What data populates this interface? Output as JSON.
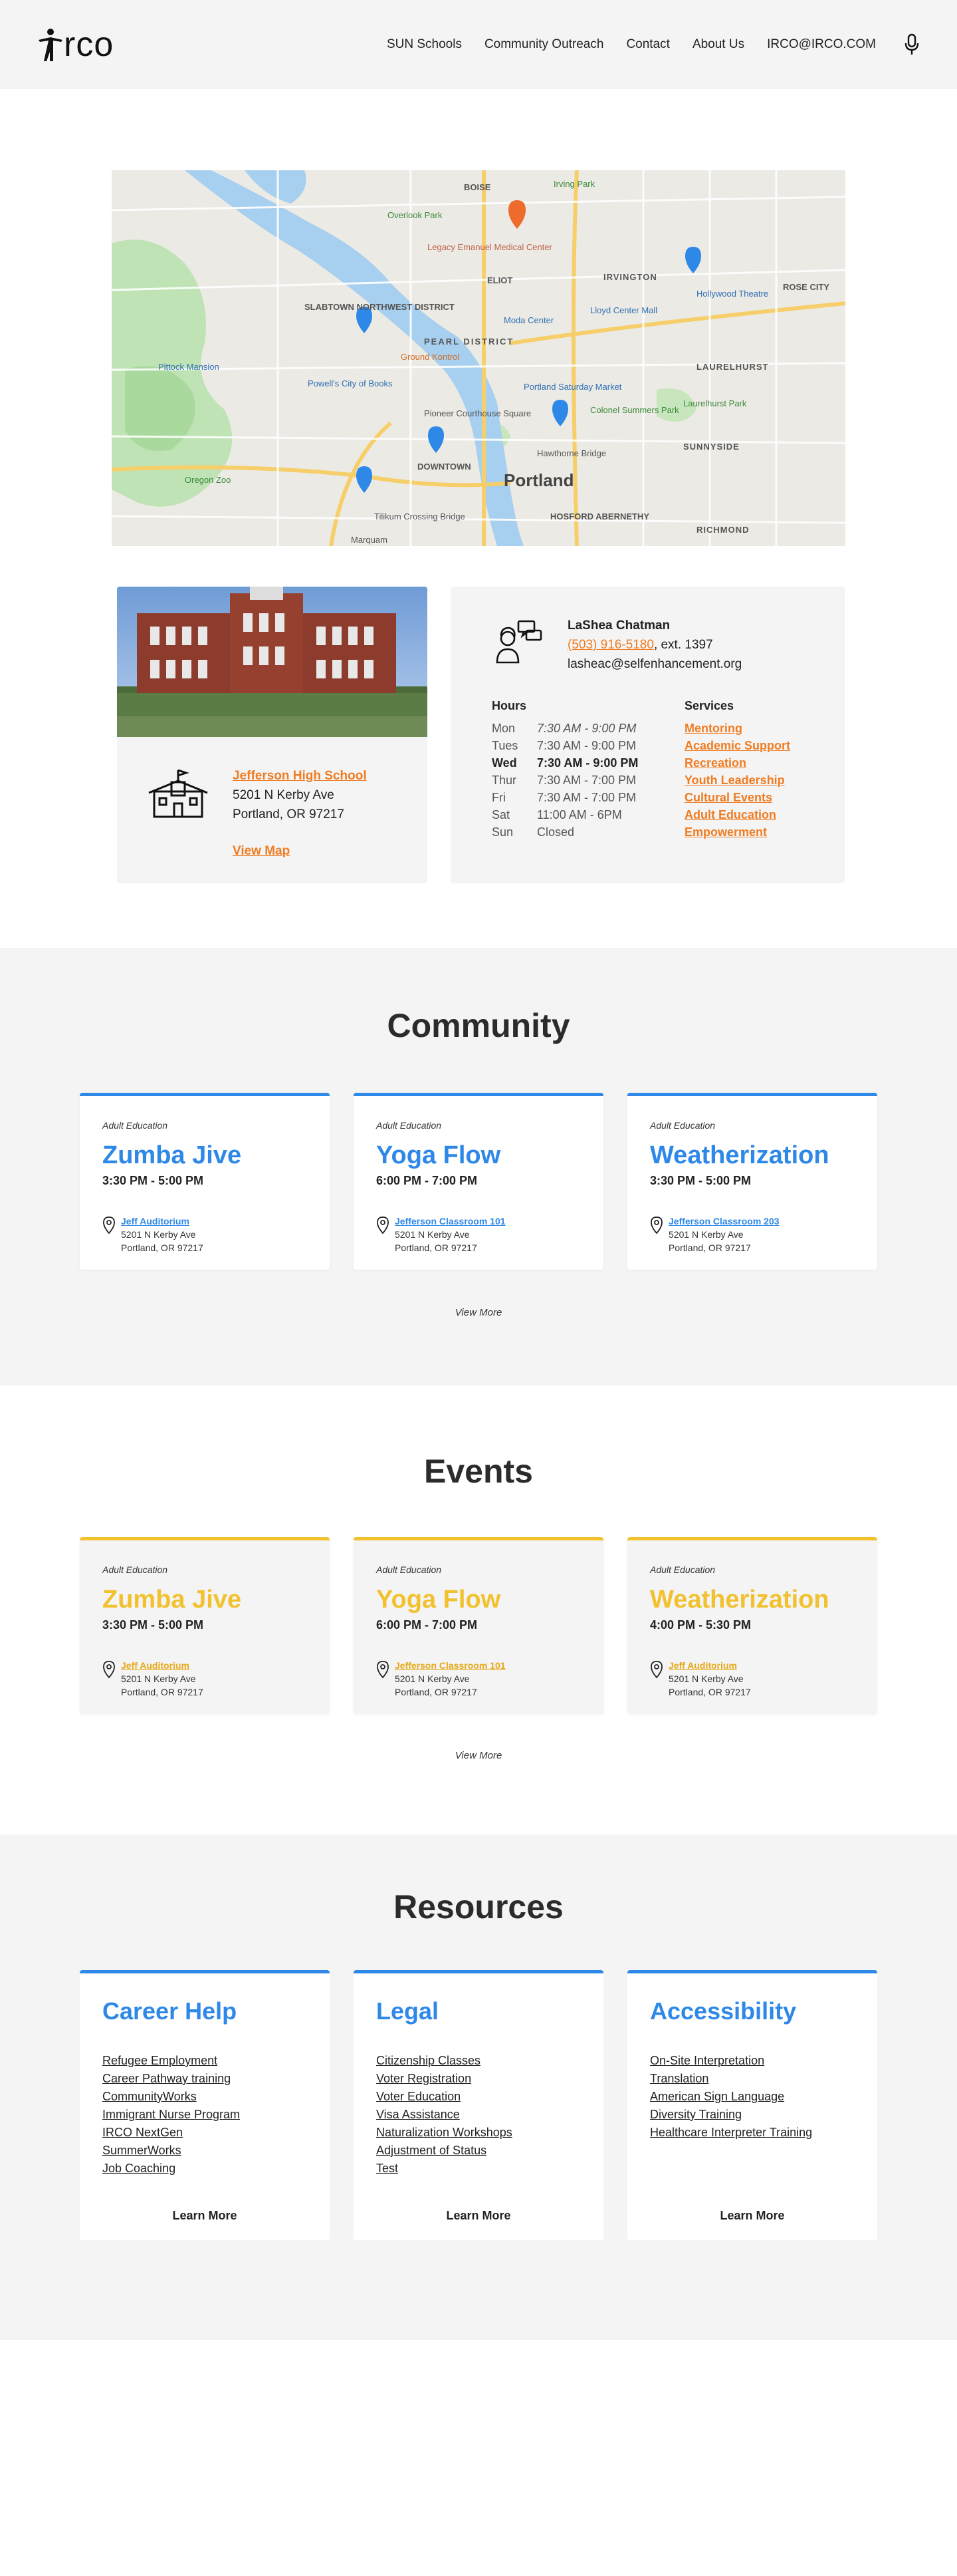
{
  "header": {
    "logo_text": "rco",
    "nav": [
      {
        "label": "SUN Schools"
      },
      {
        "label": "Community Outreach"
      },
      {
        "label": "Contact"
      },
      {
        "label": "About Us"
      },
      {
        "label": "IRCO@IRCO.COM"
      }
    ]
  },
  "map": {
    "labels": {
      "portland": "Portland",
      "pearl": "PEARL DISTRICT",
      "slabtown": "SLABTOWN NORTHWEST DISTRICT",
      "downtown": "DOWNTOWN",
      "lloyd": "Lloyd Center Mall",
      "moda": "Moda Center",
      "powells": "Powell's City of Books",
      "pioneer": "Pioneer Courthouse Square",
      "colonel": "Colonel Summers Park",
      "laurelhurst": "LAURELHURST",
      "laurelhurst_park": "Laurelhurst Park",
      "sunnyside": "SUNNYSIDE",
      "hollywood": "Hollywood Theatre",
      "rose_city": "ROSE CITY",
      "irvington": "IRVINGTON",
      "eliot": "ELIOT",
      "boise": "BOISE",
      "irving_park": "Irving Park",
      "overlook": "Overlook Park",
      "emanuel": "Legacy Emanuel Medical Center",
      "pittock": "Pittock Mansion",
      "oregon_zoo": "Oregon Zoo",
      "hawthorne": "Hawthorne Bridge",
      "tilikum": "Tilikum Crossing Bridge",
      "hosford": "HOSFORD ABERNETHY",
      "richmond": "RICHMOND",
      "saturday": "Portland Saturday Market",
      "ground": "Ground Kontrol",
      "marquam": "Marquam"
    }
  },
  "location": {
    "school_name": "Jefferson High School",
    "address1": "5201 N Kerby Ave",
    "address2": "Portland, OR 97217",
    "view_map": "View Map"
  },
  "contact": {
    "name": "LaShea Chatman",
    "phone": "(503) 916-5180",
    "ext": ", ext. 1397",
    "email": "lasheac@selfenhancement.org",
    "hours_title": "Hours",
    "hours": [
      {
        "day": "Mon",
        "time": "7:30 AM - 9:00 PM"
      },
      {
        "day": "Tues",
        "time": "7:30 AM - 9:00 PM"
      },
      {
        "day": "Wed",
        "time": "7:30 AM - 9:00 PM"
      },
      {
        "day": "Thur",
        "time": "7:30 AM - 7:00 PM"
      },
      {
        "day": "Fri",
        "time": "7:30 AM - 7:00 PM"
      },
      {
        "day": "Sat",
        "time": "11:00 AM - 6PM"
      },
      {
        "day": "Sun",
        "time": "Closed"
      }
    ],
    "services_title": "Services",
    "services": [
      "Mentoring",
      "Academic Support",
      "Recreation",
      "Youth Leadership",
      "Cultural Events",
      "Adult Education",
      "Empowerment"
    ]
  },
  "community": {
    "title": "Community",
    "view_more": "View More",
    "cards": [
      {
        "category": "Adult Education",
        "title": "Zumba Jive",
        "time": "3:30 PM - 5:00 PM",
        "location": "Jeff Auditorium",
        "address1": "5201 N Kerby Ave",
        "address2": "Portland, OR 97217"
      },
      {
        "category": "Adult Education",
        "title": "Yoga Flow",
        "time": "6:00 PM - 7:00 PM",
        "location": "Jefferson Classroom 101",
        "address1": "5201 N Kerby Ave",
        "address2": "Portland, OR 97217"
      },
      {
        "category": "Adult Education",
        "title": "Weatherization",
        "time": "3:30 PM - 5:00 PM",
        "location": "Jefferson Classroom 203",
        "address1": "5201 N Kerby Ave",
        "address2": "Portland, OR 97217"
      }
    ]
  },
  "events": {
    "title": "Events",
    "view_more": "View More",
    "cards": [
      {
        "category": "Adult Education",
        "title": "Zumba Jive",
        "time": "3:30 PM - 5:00 PM",
        "location": "Jeff Auditorium",
        "address1": "5201 N Kerby Ave",
        "address2": "Portland, OR 97217"
      },
      {
        "category": "Adult Education",
        "title": "Yoga Flow",
        "time": "6:00 PM - 7:00 PM",
        "location": "Jefferson Classroom 101",
        "address1": "5201 N Kerby Ave",
        "address2": "Portland, OR 97217"
      },
      {
        "category": "Adult Education",
        "title": "Weatherization",
        "time": "4:00 PM - 5:30 PM",
        "location": "Jeff Auditorium",
        "address1": "5201 N Kerby Ave",
        "address2": "Portland, OR 97217"
      }
    ]
  },
  "resources": {
    "title": "Resources",
    "learn_more": "Learn More",
    "cards": [
      {
        "title": "Career Help",
        "items": [
          "Refugee Employment",
          "Career Pathway training",
          "CommunityWorks",
          "Immigrant Nurse Program",
          "IRCO NextGen",
          "SummerWorks",
          "Job Coaching"
        ]
      },
      {
        "title": "Legal",
        "items": [
          "Citizenship Classes",
          "Voter Registration",
          "Voter Education",
          "Visa Assistance",
          "Naturalization Workshops",
          "Adjustment of Status",
          "Test"
        ]
      },
      {
        "title": "Accessibility",
        "items": [
          "On-Site Interpretation",
          "Translation",
          "American Sign Language",
          "Diversity Training",
          "Healthcare Interpreter Training"
        ]
      }
    ]
  },
  "colors": {
    "accent_blue": "#2e88e8",
    "accent_orange": "#f07c22",
    "accent_yellow": "#f2c12e"
  }
}
